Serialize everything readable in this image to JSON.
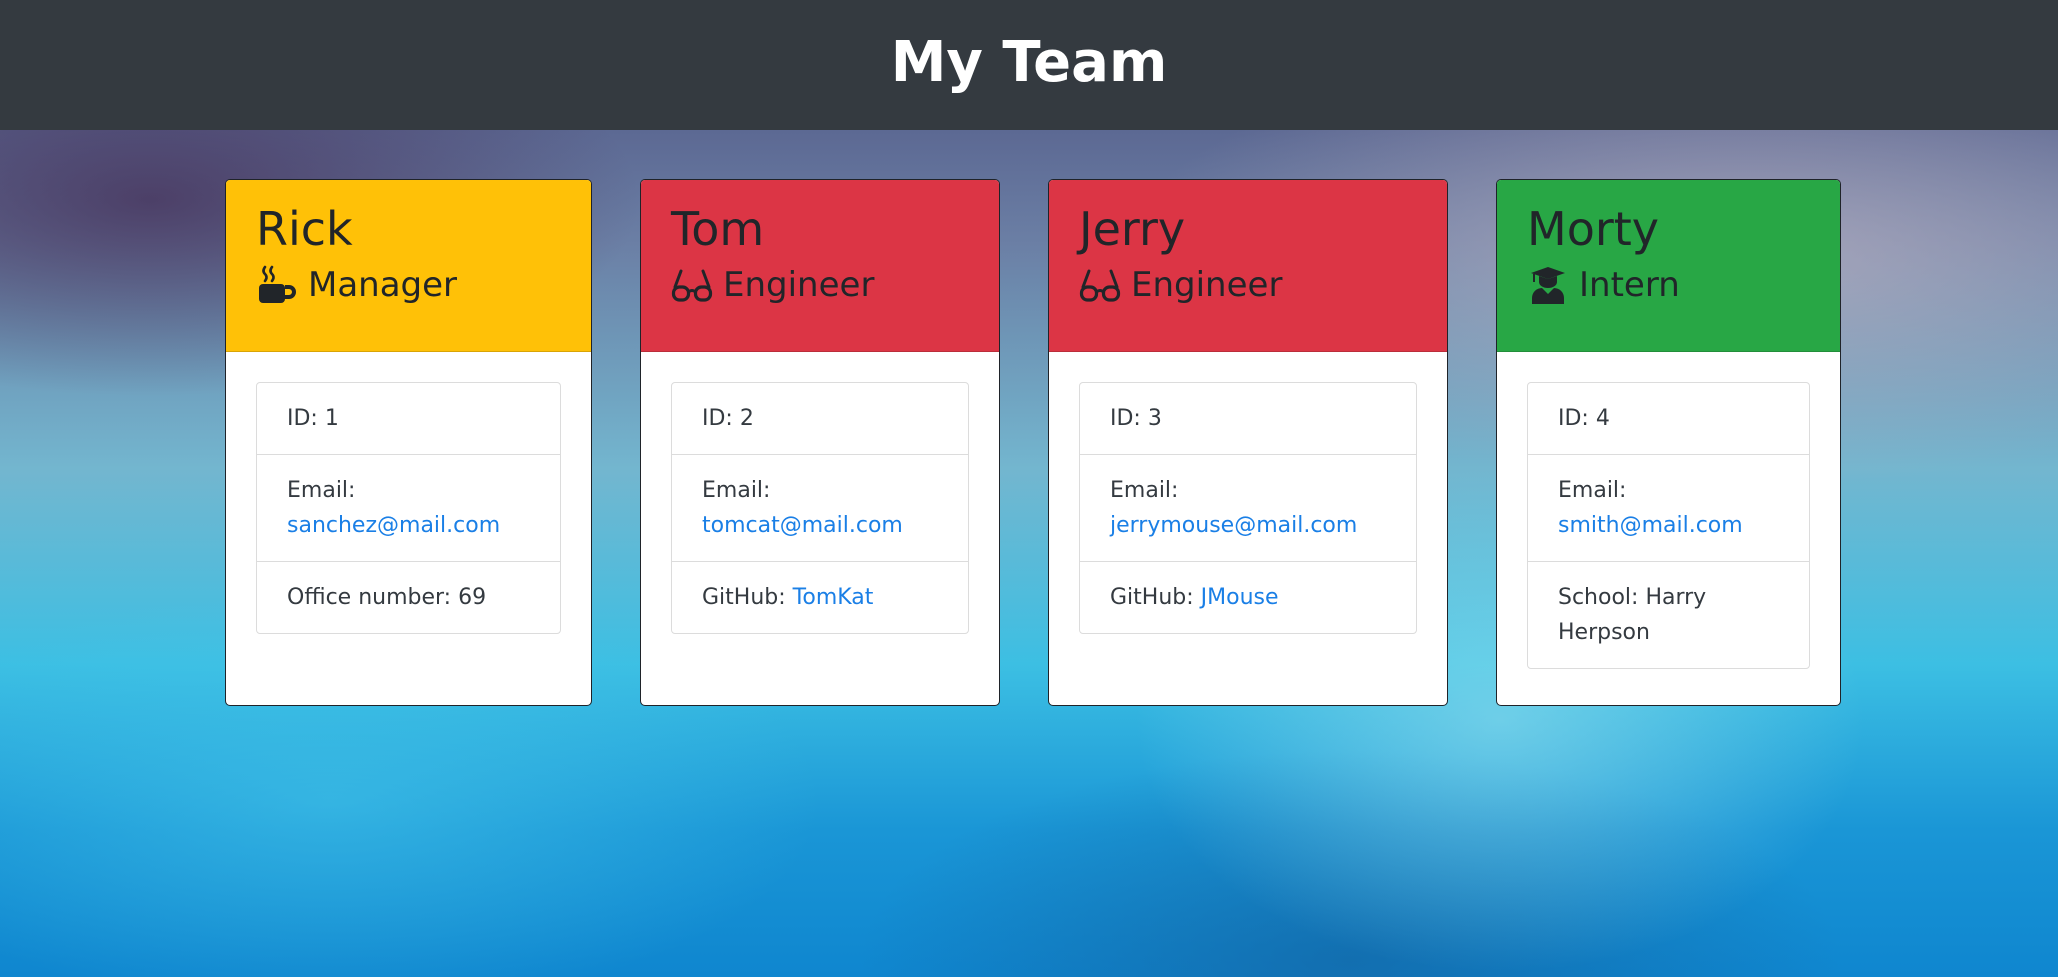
{
  "header": {
    "title": "My Team"
  },
  "team": [
    {
      "name": "Rick",
      "role": "Manager",
      "role_icon": "coffee-mug-icon",
      "header_color": "#ffc107",
      "id_text": "ID: 1",
      "email_label": "Email:",
      "email": "sanchez@mail.com",
      "extra_label": "Office number: 69",
      "extra_link": ""
    },
    {
      "name": "Tom",
      "role": "Engineer",
      "role_icon": "glasses-icon",
      "header_color": "#dc3545",
      "id_text": "ID: 2",
      "email_label": "Email:",
      "email": "tomcat@mail.com",
      "extra_label": "GitHub:",
      "extra_link": "TomKat"
    },
    {
      "name": "Jerry",
      "role": "Engineer",
      "role_icon": "glasses-icon",
      "header_color": "#dc3545",
      "id_text": "ID: 3",
      "email_label": "Email:",
      "email": "jerrymouse@mail.com",
      "extra_label": "GitHub:",
      "extra_link": "JMouse"
    },
    {
      "name": "Morty",
      "role": "Intern",
      "role_icon": "graduate-icon",
      "header_color": "#28a745",
      "id_text": "ID: 4",
      "email_label": "Email:",
      "email": "smith@mail.com",
      "extra_label": "School: Harry Herpson",
      "extra_link": ""
    }
  ]
}
